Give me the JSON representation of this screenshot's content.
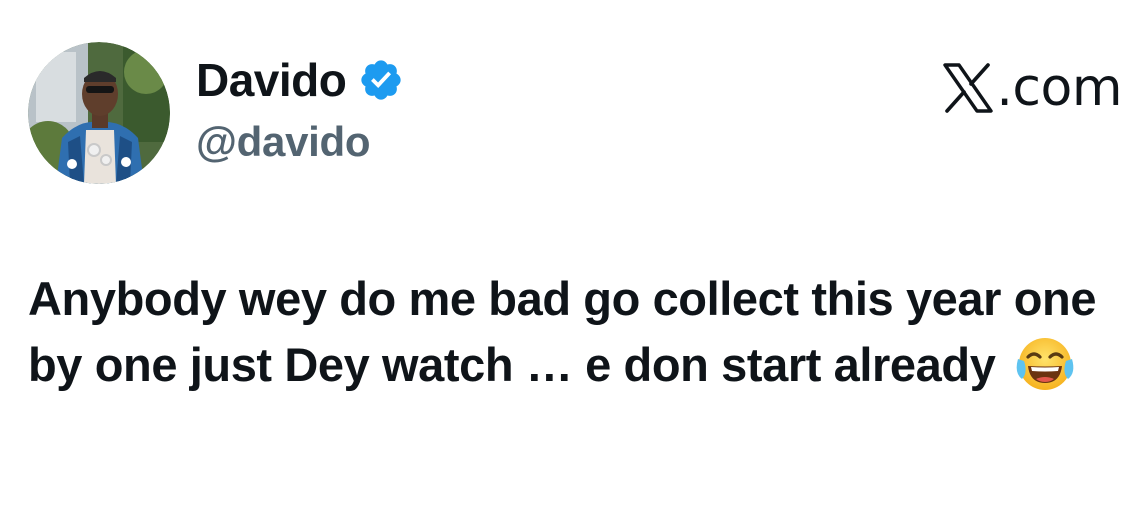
{
  "author": {
    "display_name": "Davido",
    "handle": "@davido",
    "verified": true,
    "verified_color": "#1d9bf0",
    "avatar_icon": "profile-photo"
  },
  "brand": {
    "label": ".com",
    "logo_icon": "x-logo-icon"
  },
  "tweet": {
    "text": "Anybody wey do me bad go collect this year one by one just Dey watch … e don start already",
    "emoji_icon": "face-with-tears-of-joy-icon"
  },
  "colors": {
    "text_primary": "#0f1419",
    "text_secondary": "#536471",
    "background": "#ffffff"
  }
}
